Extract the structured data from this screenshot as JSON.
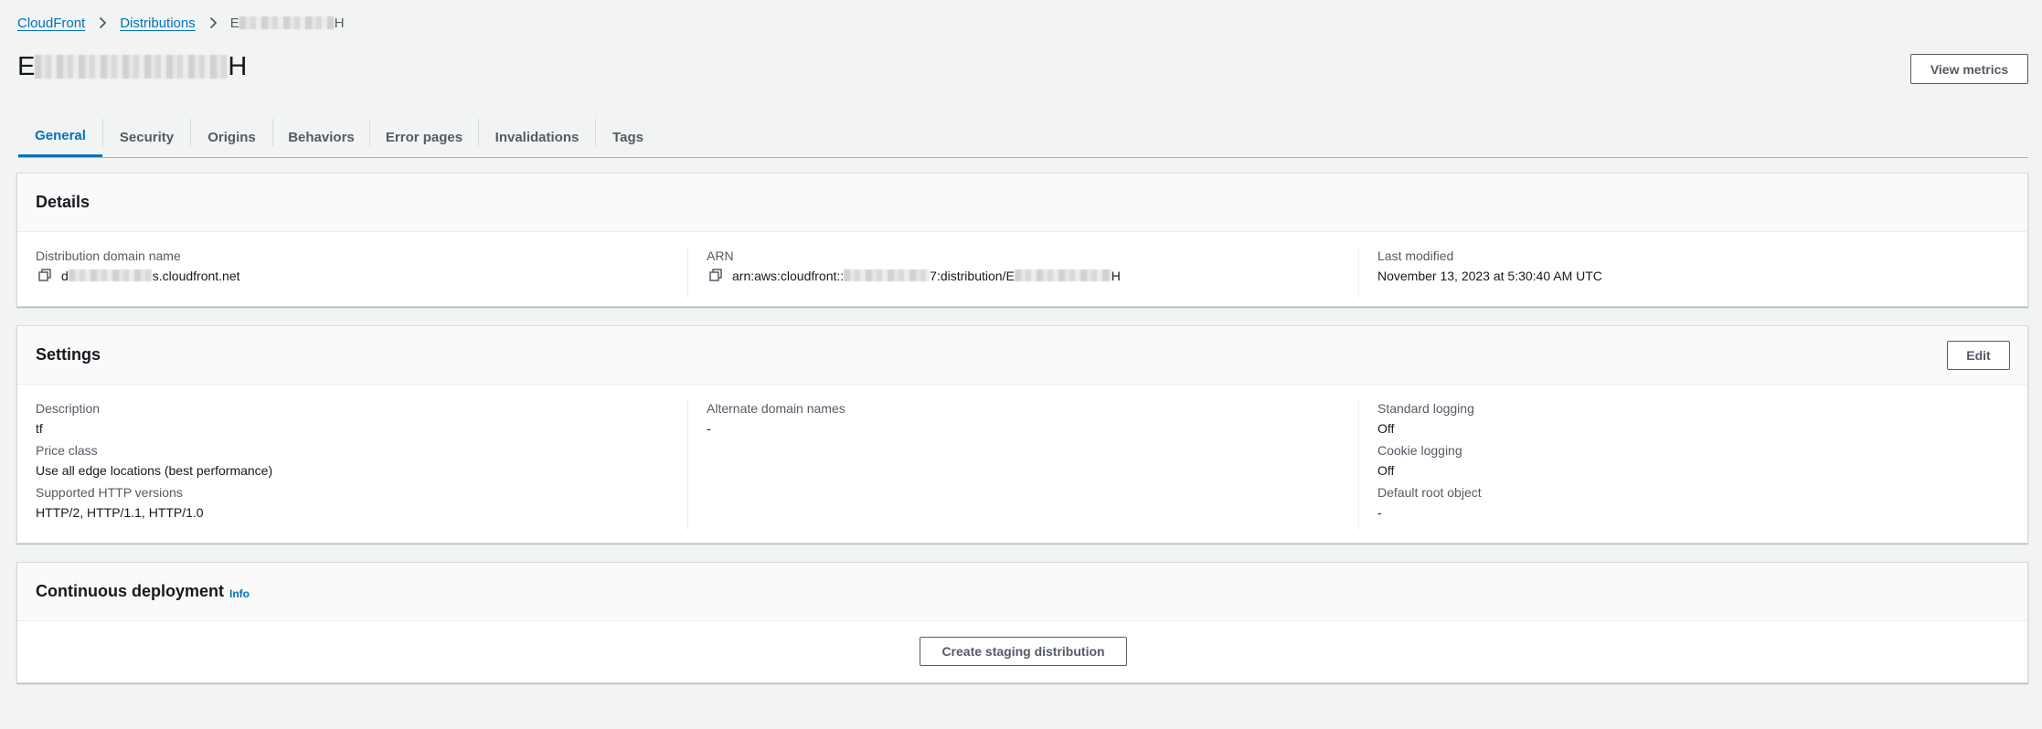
{
  "breadcrumb": {
    "items": [
      "CloudFront",
      "Distributions"
    ],
    "current_prefix": "E",
    "current_suffix": "H"
  },
  "page": {
    "title_prefix": "E",
    "title_suffix": "H",
    "view_metrics_label": "View metrics"
  },
  "tabs": [
    {
      "label": "General",
      "active": true
    },
    {
      "label": "Security"
    },
    {
      "label": "Origins"
    },
    {
      "label": "Behaviors"
    },
    {
      "label": "Error pages"
    },
    {
      "label": "Invalidations"
    },
    {
      "label": "Tags"
    }
  ],
  "details": {
    "title": "Details",
    "domain_label": "Distribution domain name",
    "domain_prefix": "d",
    "domain_suffix": "s.cloudfront.net",
    "arn_label": "ARN",
    "arn_prefix": "arn:aws:cloudfront::",
    "arn_middle": "7:distribution/E",
    "arn_suffix": "H",
    "modified_label": "Last modified",
    "modified_value": "November 13, 2023 at 5:30:40 AM UTC"
  },
  "settings": {
    "title": "Settings",
    "edit_label": "Edit",
    "description_label": "Description",
    "description_value": "tf",
    "price_label": "Price class",
    "price_value": "Use all edge locations (best performance)",
    "http_label": "Supported HTTP versions",
    "http_value": "HTTP/2, HTTP/1.1, HTTP/1.0",
    "alt_label": "Alternate domain names",
    "alt_value": "-",
    "std_log_label": "Standard logging",
    "std_log_value": "Off",
    "cookie_label": "Cookie logging",
    "cookie_value": "Off",
    "root_label": "Default root object",
    "root_value": "-"
  },
  "continuous": {
    "title": "Continuous deployment",
    "info_label": "Info",
    "create_label": "Create staging distribution"
  },
  "colors": {
    "link": "#0073bb",
    "page_bg": "#f2f3f3",
    "text": "#16191f",
    "muted": "#545b64"
  }
}
